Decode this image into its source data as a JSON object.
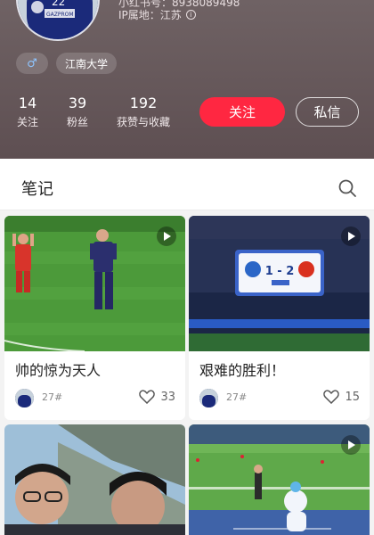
{
  "profile": {
    "xhs_id": "小红书号：8938089498",
    "ip_location": "IP属地：江苏",
    "info_glyph": "i",
    "tags": {
      "gender_symbol": "♂",
      "school": "江南大学"
    },
    "stats": {
      "following": {
        "num": "14",
        "label": "关注"
      },
      "fans": {
        "num": "39",
        "label": "粉丝"
      },
      "likes": {
        "num": "192",
        "label": "获赞与收藏"
      }
    },
    "follow_label": "关注",
    "message_label": "私信",
    "jersey_number": "22",
    "jersey_sponsor": "GAZPROM"
  },
  "tabs": {
    "notes": "笔记"
  },
  "notes": [
    {
      "title": "帅的惊为天人",
      "author": "27#",
      "likes": "33",
      "is_video": true
    },
    {
      "title": "艰难的胜利！",
      "author": "27#",
      "likes": "15",
      "is_video": true,
      "scoreboard": "1 - 2"
    },
    {
      "title": "",
      "author": "",
      "likes": "",
      "is_video": false
    },
    {
      "title": "",
      "author": "",
      "likes": "",
      "is_video": true
    }
  ],
  "colors": {
    "header_bg": "#5e4f52",
    "follow_button": "#ff2741",
    "pitch_green": "#4c9a3a"
  }
}
